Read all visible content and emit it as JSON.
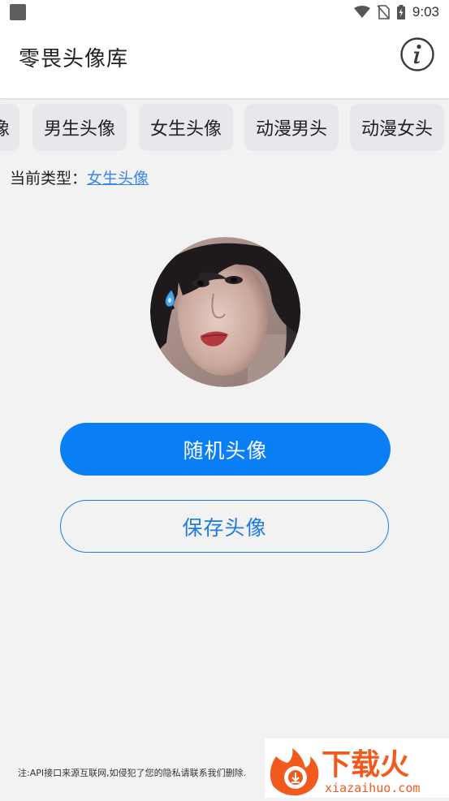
{
  "status_bar": {
    "time": "9:03",
    "icons": [
      "app-notification-icon",
      "wifi-icon",
      "no-sim-icon",
      "battery-icon"
    ]
  },
  "app_bar": {
    "title": "零畏头像库",
    "info_icon": "info-icon"
  },
  "tabs": [
    {
      "label": "像"
    },
    {
      "label": "男生头像"
    },
    {
      "label": "女生头像"
    },
    {
      "label": "动漫男头"
    },
    {
      "label": "动漫女头"
    }
  ],
  "current_type": {
    "prefix": "当前类型：",
    "value": "女生头像"
  },
  "buttons": {
    "random": "随机头像",
    "save": "保存头像"
  },
  "footer": {
    "note": "注:API接口来源互联网,如侵犯了您的隐私请联系我们删除."
  },
  "watermark": {
    "name": "下载火",
    "domain": "xiazaihuo.com"
  },
  "colors": {
    "primary": "#0a7ff5",
    "link": "#3a86e6",
    "background": "#f2f2f2",
    "watermark_orange": "#f25a1d"
  }
}
